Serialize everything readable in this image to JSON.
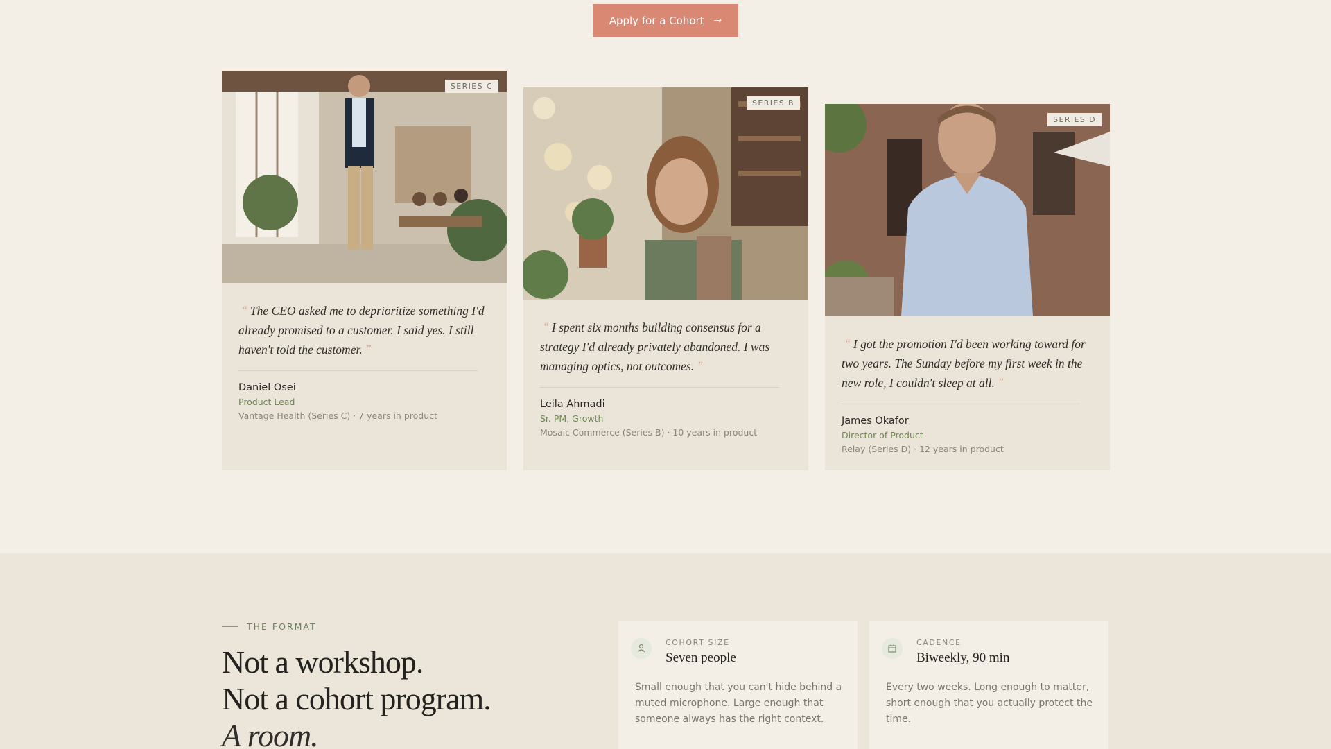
{
  "cta": {
    "label": "Apply for a Cohort",
    "icon": "arrow-right-icon"
  },
  "testimonials": [
    {
      "badge": "SERIES C",
      "quote": "The CEO asked me to deprioritize something I'd already promised to a customer. I said yes. I still haven't told the customer.",
      "name": "Daniel Osei",
      "role": "Product Lead",
      "meta": "Vantage Health (Series C) · 7 years in product"
    },
    {
      "badge": "SERIES B",
      "quote": "I spent six months building consensus for a strategy I'd already privately abandoned. I was managing optics, not outcomes.",
      "name": "Leila Ahmadi",
      "role": "Sr. PM, Growth",
      "meta": "Mosaic Commerce (Series B) · 10 years in product"
    },
    {
      "badge": "SERIES D",
      "quote": "I got the promotion I'd been working toward for two years. The Sunday before my first week in the new role, I couldn't sleep at all.",
      "name": "James Okafor",
      "role": "Director of Product",
      "meta": "Relay (Series D) · 12 years in product"
    }
  ],
  "format": {
    "eyebrow": "THE FORMAT",
    "headline_line1": "Not a workshop.",
    "headline_line2": "Not a cohort program.",
    "headline_line3": "A room.",
    "cards": [
      {
        "icon": "people-icon",
        "label": "COHORT SIZE",
        "value": "Seven people",
        "description": "Small enough that you can't hide behind a muted microphone. Large enough that someone always has the right context."
      },
      {
        "icon": "calendar-icon",
        "label": "CADENCE",
        "value": "Biweekly, 90 min",
        "description": "Every two weeks. Long enough to matter, short enough that you actually protect the time."
      }
    ]
  }
}
